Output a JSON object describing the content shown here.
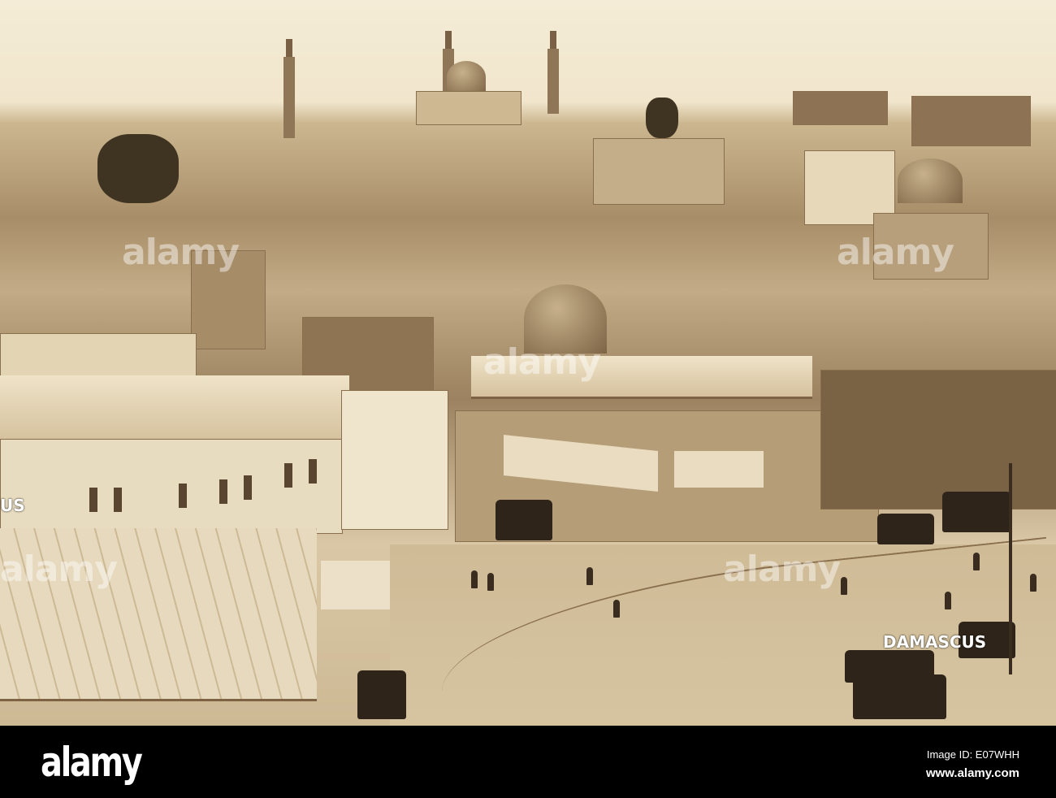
{
  "photo": {
    "subject": "Damascus",
    "shop_sign": "DAMASCUS",
    "edge_sign": "US",
    "watermarks": [
      "alamy",
      "alamy",
      "alamy",
      "alamy",
      "alamy",
      "alamy",
      "alamy"
    ],
    "colors": {
      "sky": "#f2e8d0",
      "sepia_mid": "#a88e68",
      "shadow": "#3a2d20"
    }
  },
  "bar": {
    "logo": "alamy",
    "image_id": "Image ID: E07WHH",
    "url": "www.alamy.com"
  }
}
